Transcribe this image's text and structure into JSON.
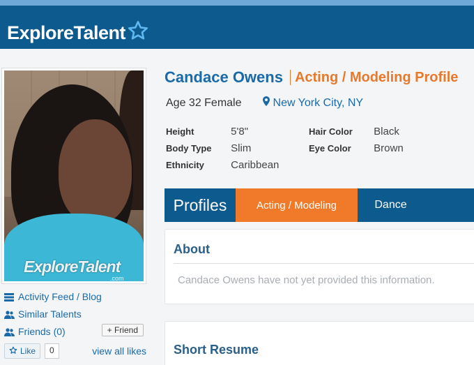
{
  "header": {
    "logo_text": "ExploreTalent",
    "logo_icon": "star-icon",
    "bg_color": "#0d5a8f"
  },
  "sidebar": {
    "photo_watermark": "ExploreTalent",
    "photo_watermark_sub": ".com",
    "links": [
      {
        "label": "Activity Feed / Blog",
        "icon": "list-icon"
      },
      {
        "label": "Similar Talents",
        "icon": "users-icon"
      },
      {
        "label": "Friends (0)",
        "icon": "users-icon"
      }
    ],
    "friend_button": "+ Friend",
    "like_button": "Like",
    "like_count": "0",
    "view_all_likes": "view all likes"
  },
  "profile": {
    "name": "Candace Owens",
    "type": "Acting / Modeling Profile",
    "age_gender": "Age 32 Female",
    "location": "New York City, NY",
    "attributes": {
      "height_label": "Height",
      "height_value": "5'8\"",
      "body_label": "Body Type",
      "body_value": "Slim",
      "ethnicity_label": "Ethnicity",
      "ethnicity_value": "Caribbean",
      "hair_label": "Hair Color",
      "hair_value": "Black",
      "eye_label": "Eye Color",
      "eye_value": "Brown"
    }
  },
  "tabs": {
    "title": "Profiles",
    "items": [
      "Acting / Modeling",
      "Dance"
    ],
    "active": "Acting / Modeling",
    "accent": "#f07a2a"
  },
  "about": {
    "heading": "About",
    "message": "Candace Owens have not yet provided this information."
  },
  "resume": {
    "heading": "Short Resume"
  }
}
